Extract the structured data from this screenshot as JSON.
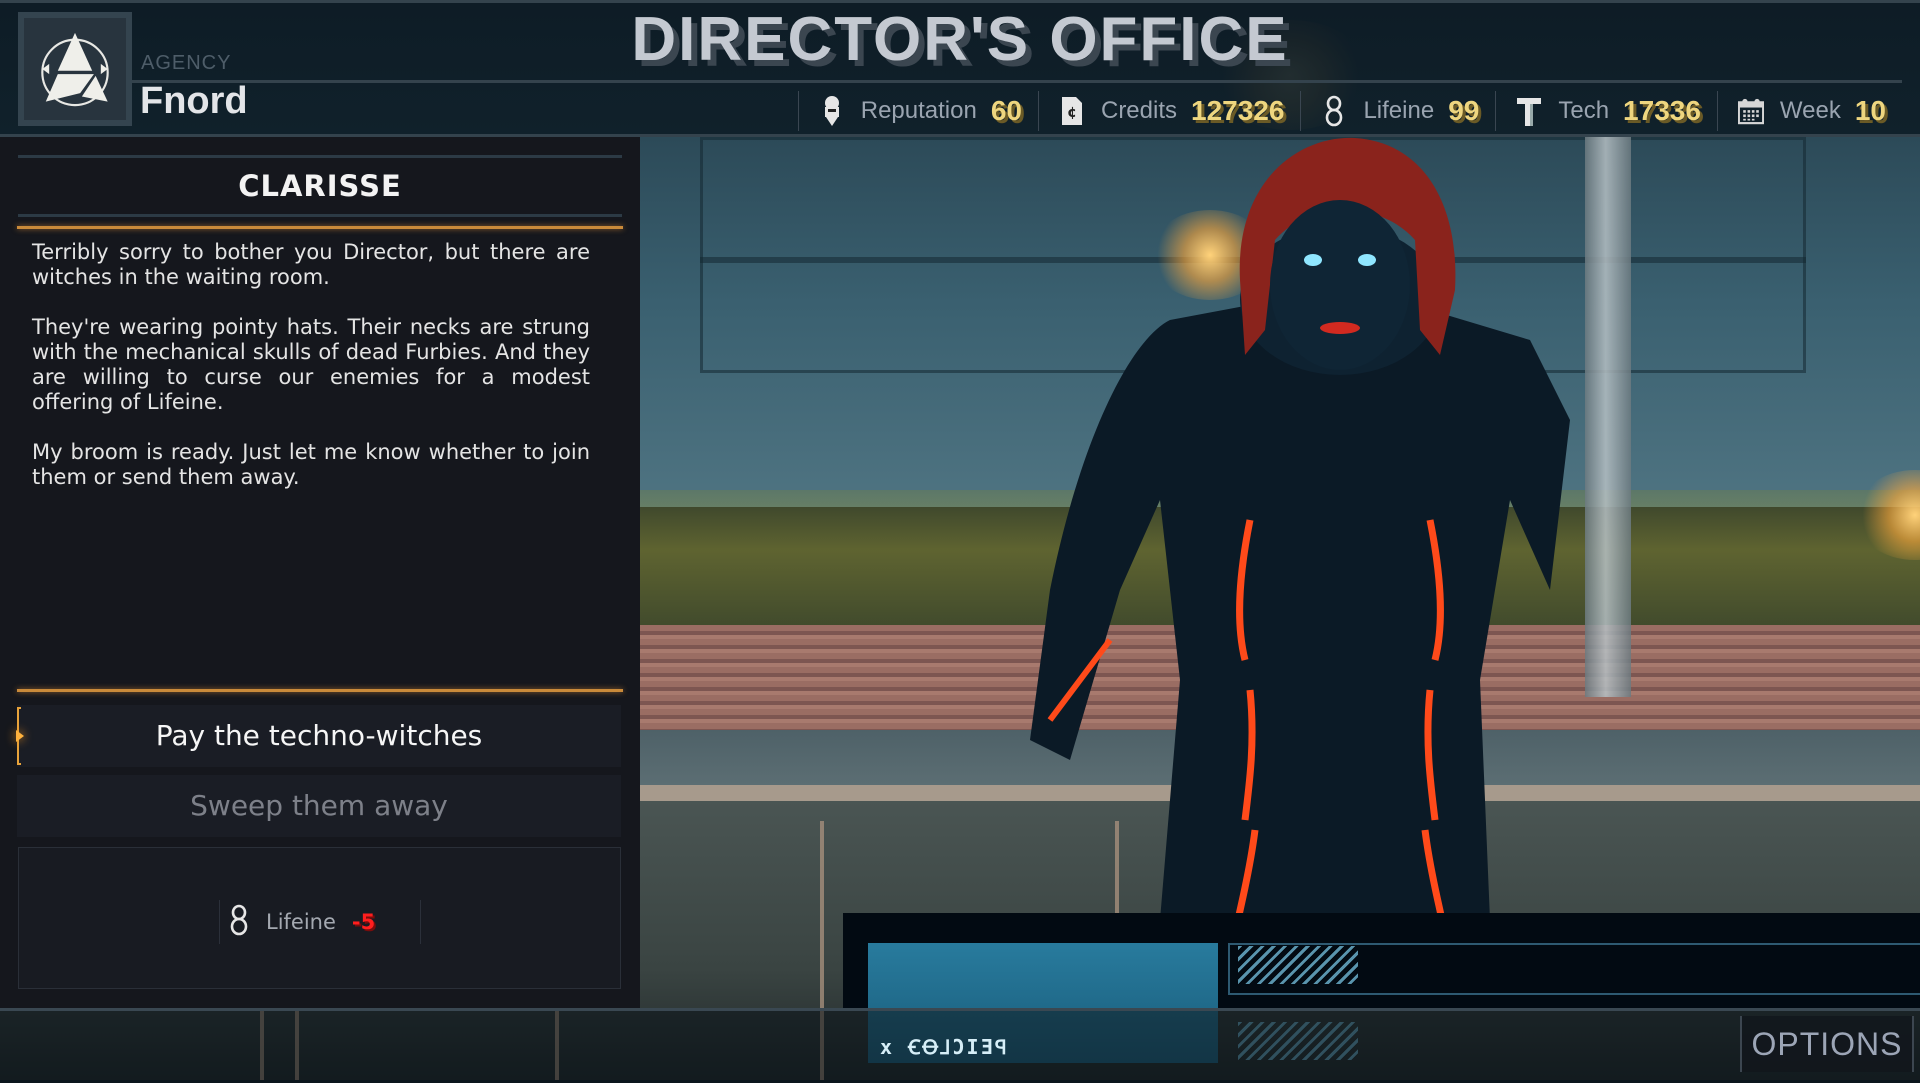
{
  "header": {
    "title": "DIRECTOR'S OFFICE",
    "agency_label": "AGENCY",
    "agency_name": "Fnord",
    "logo_icon": "agency-triangle-emblem-icon"
  },
  "stats": [
    {
      "icon": "reputation-badge-icon",
      "label": "Reputation",
      "value": "60"
    },
    {
      "icon": "credits-card-icon",
      "label": "Credits",
      "value": "127326"
    },
    {
      "icon": "lifeine-figure-eight-icon",
      "label": "Lifeine",
      "value": "99"
    },
    {
      "icon": "tech-hammer-icon",
      "label": "Tech",
      "value": "17336"
    },
    {
      "icon": "calendar-icon",
      "label": "Week",
      "value": "10"
    }
  ],
  "dialog": {
    "speaker": "CLARISSE",
    "paragraphs": [
      "Terribly sorry to bother you Director, but there are witches in the waiting room.",
      "They're wearing pointy hats. Their necks are strung with the mechanical skulls of dead Furbies. And they are willing to curse our enemies for a modest offering of Lifeine.",
      "My broom is ready. Just let me know whether to join them or send them away."
    ]
  },
  "choices": [
    {
      "label": "Pay the techno-witches",
      "selected": true
    },
    {
      "label": "Sweep them away",
      "selected": false
    }
  ],
  "effects": [
    {
      "icon": "lifeine-figure-eight-icon",
      "label": "Lifeine",
      "value": "-5",
      "color": "#ff1e1e"
    }
  ],
  "footer": {
    "options_label": "OPTIONS"
  },
  "colors": {
    "accent_orange": "#c98a3a",
    "stat_value": "#eed67f",
    "negative": "#ff1e1e"
  }
}
